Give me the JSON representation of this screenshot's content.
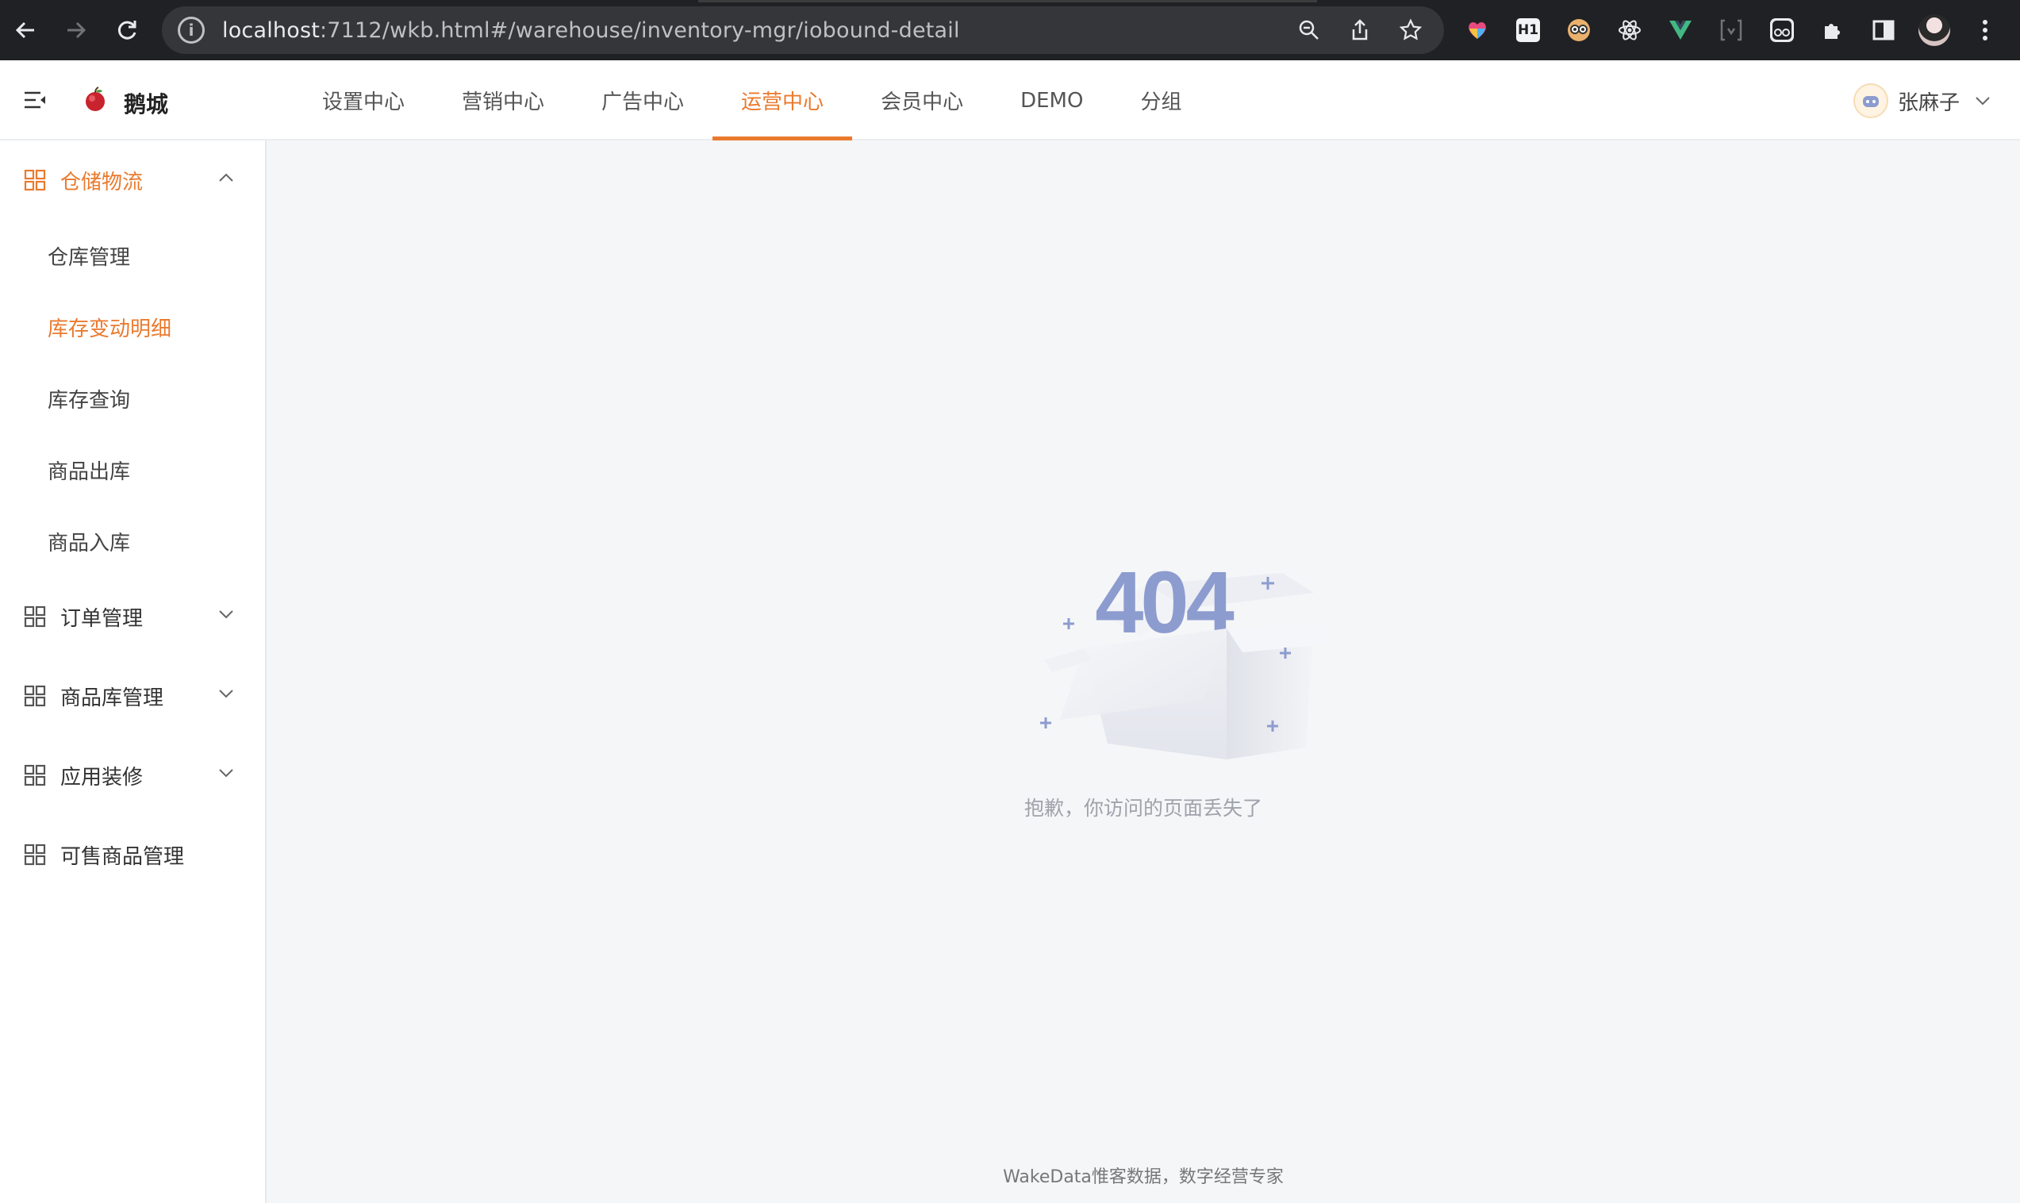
{
  "browser": {
    "url_host": "localhost",
    "url_rest": ":7112/wkb.html#/warehouse/inventory-mgr/iobound-detail"
  },
  "header": {
    "brand": "鹅城",
    "nav": [
      {
        "label": "设置中心",
        "active": false
      },
      {
        "label": "营销中心",
        "active": false
      },
      {
        "label": "广告中心",
        "active": false
      },
      {
        "label": "运营中心",
        "active": true
      },
      {
        "label": "会员中心",
        "active": false
      },
      {
        "label": "DEMO",
        "active": false
      },
      {
        "label": "分组",
        "active": false
      }
    ],
    "user_name": "张麻子"
  },
  "sidebar": {
    "groups": [
      {
        "label": "仓储物流",
        "open": true,
        "items": [
          {
            "label": "仓库管理",
            "active": false
          },
          {
            "label": "库存变动明细",
            "active": true
          },
          {
            "label": "库存查询",
            "active": false
          },
          {
            "label": "商品出库",
            "active": false
          },
          {
            "label": "商品入库",
            "active": false
          }
        ]
      },
      {
        "label": "订单管理",
        "open": false
      },
      {
        "label": "商品库管理",
        "open": false
      },
      {
        "label": "应用装修",
        "open": false
      },
      {
        "label": "可售商品管理",
        "open": false
      }
    ]
  },
  "main": {
    "error_code": "404",
    "message": "抱歉，你访问的页面丢失了",
    "footer": "WakeData惟客数据，数字经营专家"
  },
  "colors": {
    "accent": "#ea7a2e",
    "illustration": "#8d9ccf"
  }
}
